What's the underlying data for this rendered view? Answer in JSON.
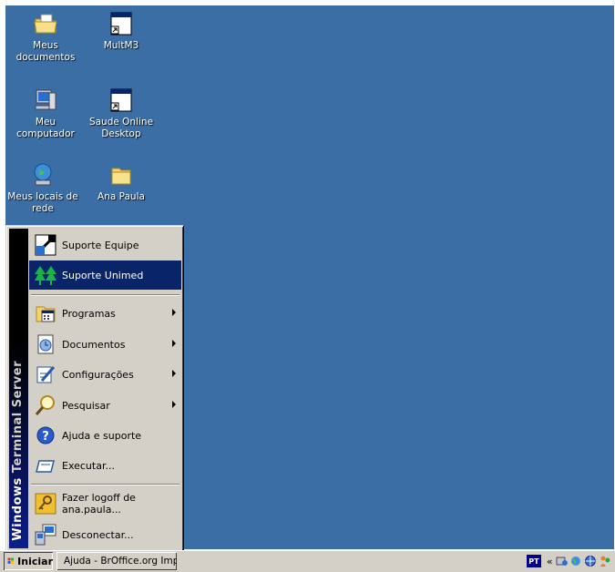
{
  "desktop_icons": [
    {
      "label": "Meus documentos"
    },
    {
      "label": "MultM3"
    },
    {
      "label": "Meu computador"
    },
    {
      "label": "Saude Online Desktop"
    },
    {
      "label": "Meus locais de rede"
    },
    {
      "label": "Ana Paula"
    }
  ],
  "start_menu": {
    "banner_bold": "Windows",
    "banner_rest": " Terminal Server",
    "items": [
      {
        "label": "Suporte Equipe"
      },
      {
        "label": "Suporte Unimed"
      },
      {
        "label": "Programas"
      },
      {
        "label": "Documentos"
      },
      {
        "label": "Configurações"
      },
      {
        "label": "Pesquisar"
      },
      {
        "label": "Ajuda e suporte"
      },
      {
        "label": "Executar..."
      },
      {
        "label": "Fazer logoff de ana.paula..."
      },
      {
        "label": "Desconectar..."
      }
    ]
  },
  "taskbar": {
    "start_label": "Iniciar",
    "task_label": "Ajuda - BrOffice.org Imp...",
    "language": "PT",
    "chevron": "«"
  },
  "colors": {
    "desktop": "#3a6ea5",
    "selection": "#0a246a",
    "chrome": "#d4d0c8"
  }
}
